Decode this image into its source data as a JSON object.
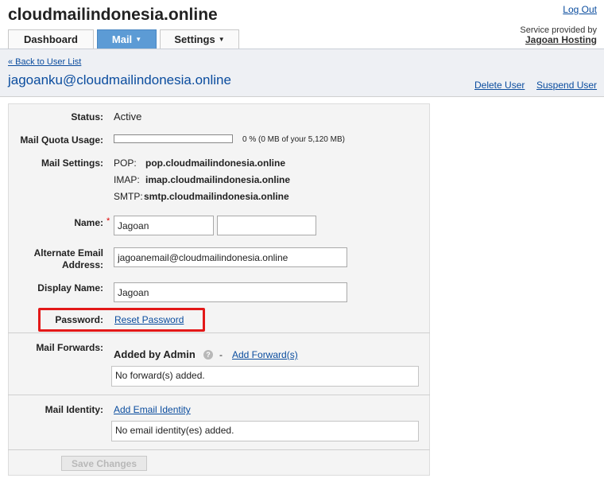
{
  "header": {
    "site_title": "cloudmailindonesia.online",
    "logout_label": "Log Out",
    "service_text": "Service provided by",
    "service_provider": "Jagoan Hosting"
  },
  "tabs": [
    {
      "label": "Dashboard",
      "active": false
    },
    {
      "label": "Mail",
      "active": true
    },
    {
      "label": "Settings",
      "active": false
    }
  ],
  "page": {
    "back_link": "« Back to User List",
    "user_email": "jagoanku@cloudmailindonesia.online",
    "delete_user": "Delete User",
    "suspend_user": "Suspend User"
  },
  "form": {
    "status_label": "Status:",
    "status_value": "Active",
    "quota_label": "Mail Quota Usage:",
    "quota_percent": 0,
    "quota_text": "0 % (0 MB of your 5,120 MB)",
    "mail_settings_label": "Mail Settings:",
    "pop_label": "POP:",
    "pop_value": "pop.cloudmailindonesia.online",
    "imap_label": "IMAP:",
    "imap_value": "imap.cloudmailindonesia.online",
    "smtp_label": "SMTP:",
    "smtp_value": "smtp.cloudmailindonesia.online",
    "name_label": "Name:",
    "required_mark": "*",
    "first_name": "Jagoan",
    "last_name": "",
    "alt_email_label_line1": "Alternate Email",
    "alt_email_label_line2": "Address:",
    "alt_email_value": "jagoanemail@cloudmailindonesia.online",
    "display_name_label": "Display Name:",
    "display_name_value": "Jagoan",
    "password_label": "Password:",
    "reset_password": "Reset Password",
    "mail_forwards_label": "Mail Forwards:",
    "added_by_admin": "Added by Admin",
    "info_icon_glyph": "?",
    "separator": "-",
    "add_forward": "Add Forward(s)",
    "no_forwards": "No forward(s) added.",
    "mail_identity_label": "Mail Identity:",
    "add_identity": "Add Email Identity",
    "no_identity": "No email identity(es) added.",
    "save_changes": "Save Changes"
  },
  "colors": {
    "link": "#0a4c9e",
    "active_tab": "#5c9bd5",
    "highlight": "#e31818"
  }
}
